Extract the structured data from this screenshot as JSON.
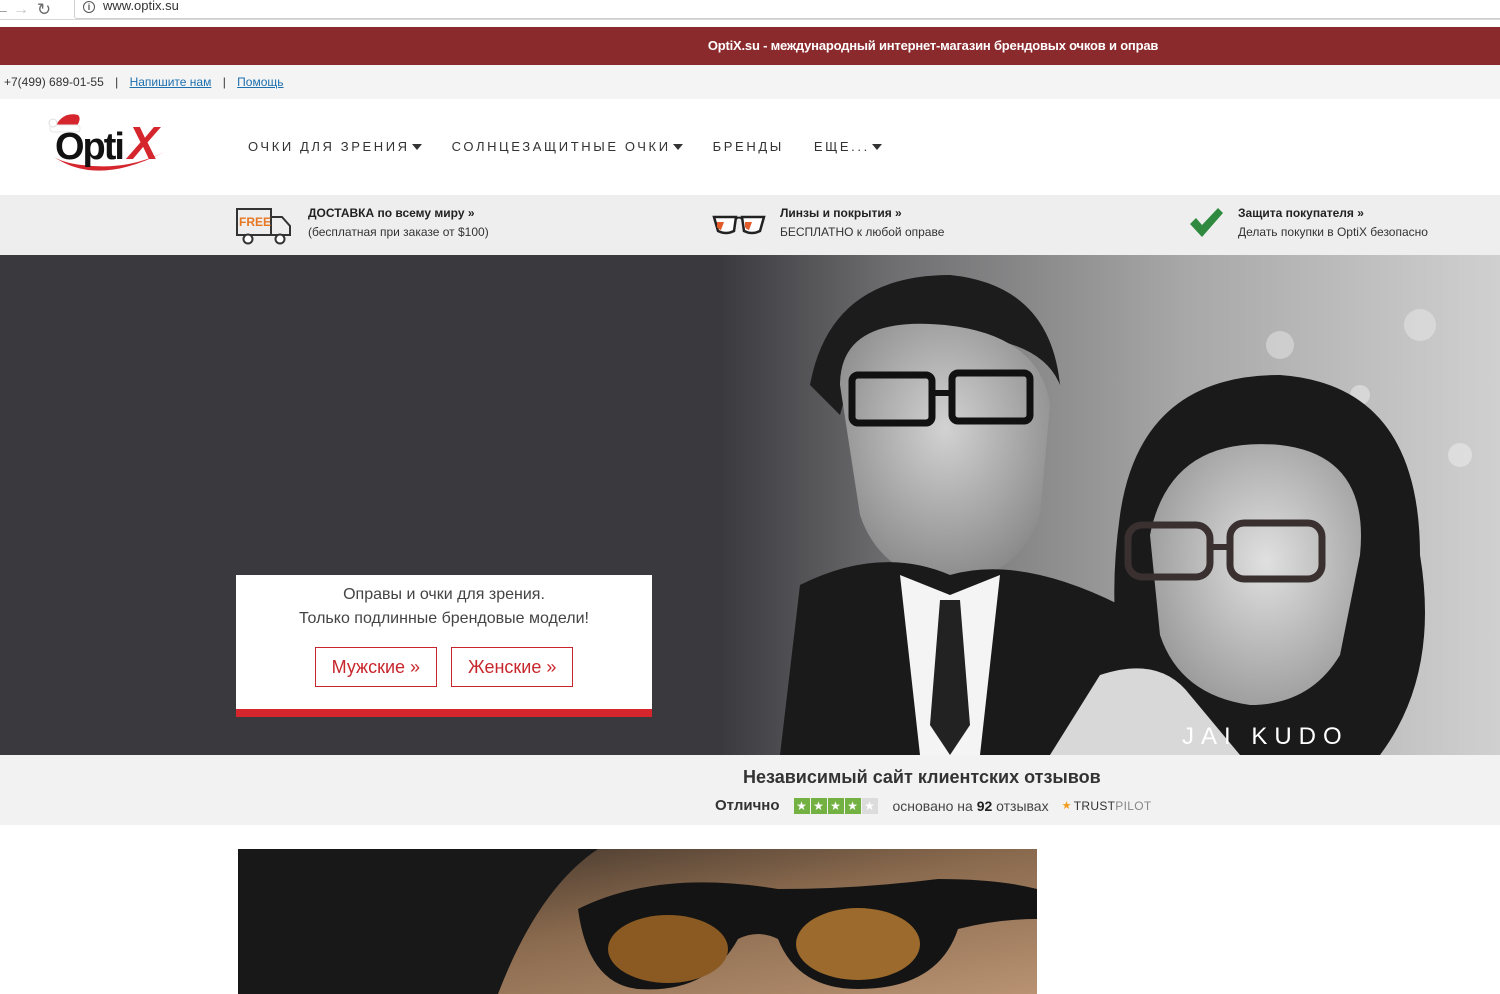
{
  "browser": {
    "back_icon": "arrow-left-icon",
    "forward_icon": "arrow-right-icon",
    "reload_icon": "reload-icon",
    "info_icon": "info-icon",
    "url": "www.optix.su"
  },
  "banner": {
    "text": "OptiX.su - международный интернет-магазин брендовых очков и оправ",
    "color": "#8b2a2d"
  },
  "contact": {
    "phone": "+7(499) 689-01-55",
    "separator": "|",
    "write_us": "Напишите нам",
    "help": "Помощь"
  },
  "logo": {
    "text": "OptiX",
    "accent": "#d5262d"
  },
  "nav": {
    "items": [
      {
        "label": "ОЧКИ ДЛЯ ЗРЕНИЯ",
        "dropdown": true
      },
      {
        "label": "СОЛНЦЕЗАЩИТНЫЕ ОЧКИ",
        "dropdown": true
      },
      {
        "label": "БРЕНДЫ",
        "dropdown": false
      },
      {
        "label": "ЕЩЕ...",
        "dropdown": true
      }
    ]
  },
  "features": [
    {
      "icon": "free-delivery-truck-icon",
      "badge": "FREE",
      "title": "ДОСТАВКА по всему миру »",
      "subtitle": "(бесплатная при заказе от $100)"
    },
    {
      "icon": "glasses-icon",
      "title": "Линзы и покрытия »",
      "subtitle": "БЕСПЛАТНО к любой оправе"
    },
    {
      "icon": "checkmark-icon",
      "title": "Защита покупателя »",
      "subtitle": "Делать покупки в OptiX безопасно"
    }
  ],
  "hero": {
    "brand_caption": "JAI KUDO",
    "promo_line1": "Оправы и очки для зрения.",
    "promo_line2": "Только подлинные брендовые модели!",
    "btn_men": "Мужские »",
    "btn_women": "Женские »",
    "accent": "#d5262d"
  },
  "reviews": {
    "title": "Независимый сайт клиентских отзывов",
    "rating_word": "Отлично",
    "stars_filled": 4,
    "stars_total": 5,
    "based_on": "основано на",
    "count": "92",
    "reviews_word": "отзывах",
    "trustpilot_a": "TRUST",
    "trustpilot_b": "PILOT",
    "star_color": "#73b143"
  }
}
